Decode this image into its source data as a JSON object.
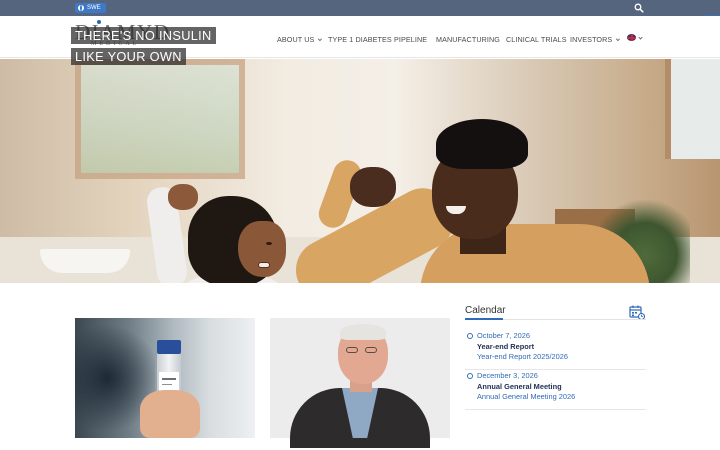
{
  "topbar": {
    "language_toggle": "SWE",
    "search_icon": "search-icon",
    "cart_icon": "cart-icon"
  },
  "brand": {
    "logo_text": "DIAMYD",
    "logo_subtext": "MEDICAL"
  },
  "nav": {
    "items": [
      {
        "label": "ABOUT US",
        "has_dropdown": true
      },
      {
        "label": "TYPE 1 DIABETES",
        "has_dropdown": false
      },
      {
        "label": "PIPELINE",
        "has_dropdown": false
      },
      {
        "label": "MANUFACTURING",
        "has_dropdown": false
      },
      {
        "label": "CLINICAL TRIALS",
        "has_dropdown": false
      },
      {
        "label": "INVESTORS",
        "has_dropdown": true
      }
    ],
    "language_flag_icon": "uk-flag-icon"
  },
  "hero": {
    "headline_line1": "THERE'S NO INSULIN",
    "headline_line2": "LIKE YOUR OWN"
  },
  "calendar": {
    "title": "Calendar",
    "icon": "calendar-icon",
    "events": [
      {
        "date": "October 7, 2026",
        "title": "Year-end Report",
        "description": "Year-end Report 2025/2026"
      },
      {
        "date": "December 3, 2026",
        "title": "Annual General Meeting",
        "description": "Annual General Meeting 2026"
      }
    ]
  },
  "colors": {
    "topbar": "#56657e",
    "accent": "#2f6bb7",
    "event_title": "#1f2f52"
  }
}
